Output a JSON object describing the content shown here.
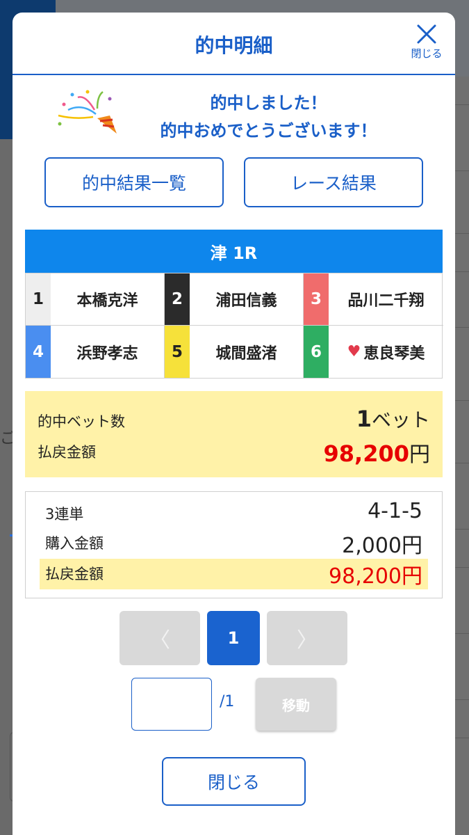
{
  "modal": {
    "title": "的中明細",
    "close_label": "閉じる"
  },
  "congrats": {
    "line1": "的中しました！",
    "line2": "的中おめでとうございます！"
  },
  "buttons": {
    "hit_list": "的中結果一覧",
    "race_result": "レース結果"
  },
  "race": {
    "title": "津 1R",
    "racers": [
      {
        "num": "1",
        "name": "本橋克洋",
        "bg": "#eeeeee",
        "fg": "#222222",
        "heart": false
      },
      {
        "num": "2",
        "name": "浦田信義",
        "bg": "#2b2b2b",
        "fg": "#ffffff",
        "heart": false
      },
      {
        "num": "3",
        "name": "品川二千翔",
        "bg": "#f06c6c",
        "fg": "#ffffff",
        "heart": false
      },
      {
        "num": "4",
        "name": "浜野孝志",
        "bg": "#4a8ef0",
        "fg": "#ffffff",
        "heart": false
      },
      {
        "num": "5",
        "name": "城間盛渚",
        "bg": "#f6e13a",
        "fg": "#222222",
        "heart": false
      },
      {
        "num": "6",
        "name": "恵良琴美",
        "bg": "#2eae62",
        "fg": "#ffffff",
        "heart": true
      }
    ]
  },
  "summary": {
    "bets_label": "的中ベット数",
    "bets_value": "1",
    "bets_unit": "ベット",
    "payout_label": "払戻金額",
    "payout_value": "98,200",
    "payout_unit": "円"
  },
  "detail": {
    "type_label": "3連単",
    "type_value": "4-1-5",
    "purchase_label": "購入金額",
    "purchase_value": "2,000円",
    "payout_label": "払戻金額",
    "payout_value": "98,200円"
  },
  "pager": {
    "prev": "〈",
    "current": "1",
    "next": "〉",
    "input_value": "",
    "total": "/1",
    "move": "移動"
  },
  "footer": {
    "close": "閉じる"
  },
  "background": {
    "left_glyph": "ご"
  },
  "colors": {
    "accent": "#1a5fc8",
    "race_bar": "#0e86ec",
    "highlight": "#fff2a8",
    "payout_red": "#e60000"
  }
}
